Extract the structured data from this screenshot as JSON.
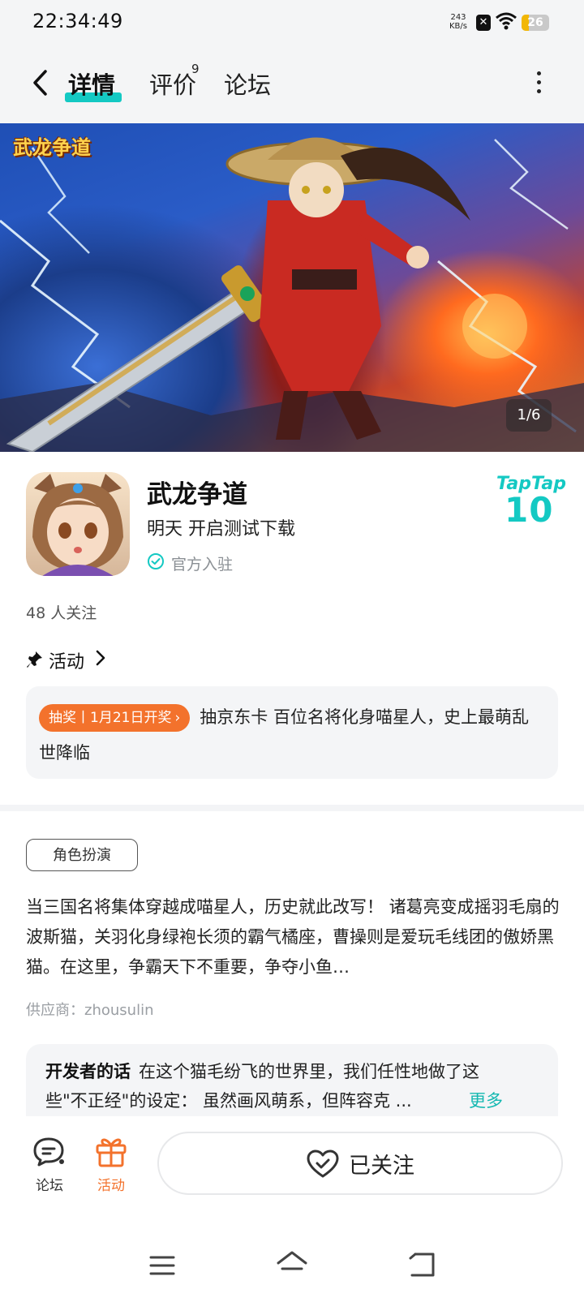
{
  "status_bar": {
    "time": "22:34:49",
    "net_speed_value": "243",
    "net_speed_unit": "KB/s",
    "battery_level": 26,
    "battery_label": "26"
  },
  "header": {
    "tabs": [
      {
        "label": "详情",
        "active": true
      },
      {
        "label": "评价",
        "badge": "9"
      },
      {
        "label": "论坛"
      }
    ]
  },
  "banner": {
    "logo_text": "武龙争道",
    "pager": "1/6"
  },
  "app": {
    "name": "武龙争道",
    "status": "明天 开启测试下载",
    "official_label": "官方入驻",
    "taptap_brand": "TapTap",
    "score": "10",
    "followers": "48 人关注"
  },
  "activity": {
    "title": "活动",
    "badge": "抽奖丨1月21日开奖",
    "text": "抽京东卡 百位名将化身喵星人，史上最萌乱世降临"
  },
  "description": {
    "genre_tag": "角色扮演",
    "text": "当三国名将集体穿越成喵星人，历史就此改写！ 诸葛亮变成摇羽毛扇的波斯猫，关羽化身绿袍长须的霸气橘座，曹操则是爱玩毛线团的傲娇黑猫。在这里，争霸天下不重要，争夺小鱼…",
    "supplier": "供应商：zhousulin"
  },
  "developer_note": {
    "title": "开发者的话",
    "text": "在这个猫毛纷飞的世界里，我们任性地做了这些\"不正经\"的设定： 虽然画风萌系，但阵容克 ...",
    "more": "更多"
  },
  "bottom_bar": {
    "forum_label": "论坛",
    "activity_label": "活动",
    "follow_label": "已关注"
  },
  "colors": {
    "accent": "#14c9c3",
    "orange": "#f3722c",
    "battery": "#f2b705"
  },
  "icons": [
    "back-icon",
    "more-icon",
    "verified-icon",
    "pin-icon",
    "chevron-right-icon",
    "forum-icon",
    "gift-icon",
    "heart-check-icon",
    "menu-icon",
    "home-icon",
    "back-nav-icon"
  ]
}
